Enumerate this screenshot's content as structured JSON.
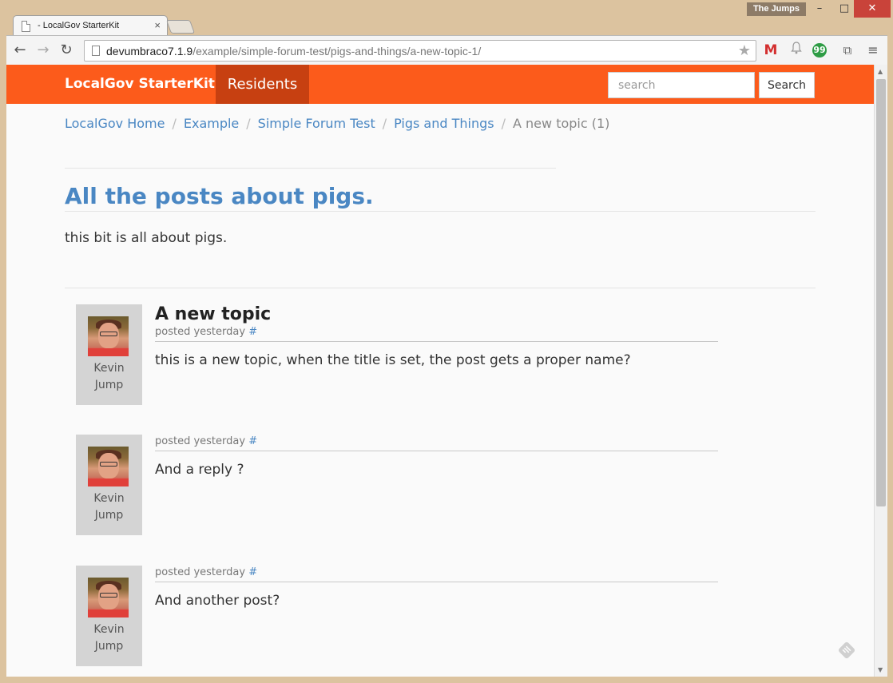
{
  "browser": {
    "tab_title": "- LocalGov StarterKit",
    "tab_close": "×",
    "profile_name": "The Jumps",
    "window_controls": {
      "minimize": "–",
      "maximize": "□",
      "close": "✕"
    },
    "nav": {
      "back": "←",
      "forward": "→",
      "reload": "↻"
    },
    "url_host": "devumbraco7.1.9",
    "url_path": "/example/simple-forum-test/pigs-and-things/a-new-topic-1/",
    "star": "★",
    "extensions": {
      "gmail": "M",
      "bell": "🔔",
      "hangouts": "99",
      "cast": "⧉",
      "menu": "≡"
    }
  },
  "site": {
    "brand": "LocalGov StarterKit",
    "nav_active": "Residents",
    "search_placeholder": "search",
    "search_button": "Search",
    "accent_color": "#fc5b1b"
  },
  "breadcrumb": {
    "items": [
      "LocalGov Home",
      "Example",
      "Simple Forum Test",
      "Pigs and Things"
    ],
    "current": "A new topic (1)"
  },
  "forum": {
    "title": "All the posts about pigs.",
    "description": "this bit is all about pigs."
  },
  "posts": [
    {
      "title": "A new topic",
      "author_first": "Kevin",
      "author_last": "Jump",
      "meta": "posted yesterday",
      "permalink": "#",
      "body": "this is a new topic, when the title is set, the post gets a proper name?"
    },
    {
      "title": "",
      "author_first": "Kevin",
      "author_last": "Jump",
      "meta": "posted yesterday",
      "permalink": "#",
      "body": "And a reply ?"
    },
    {
      "title": "",
      "author_first": "Kevin",
      "author_last": "Jump",
      "meta": "posted yesterday",
      "permalink": "#",
      "body": "And another post?"
    }
  ]
}
